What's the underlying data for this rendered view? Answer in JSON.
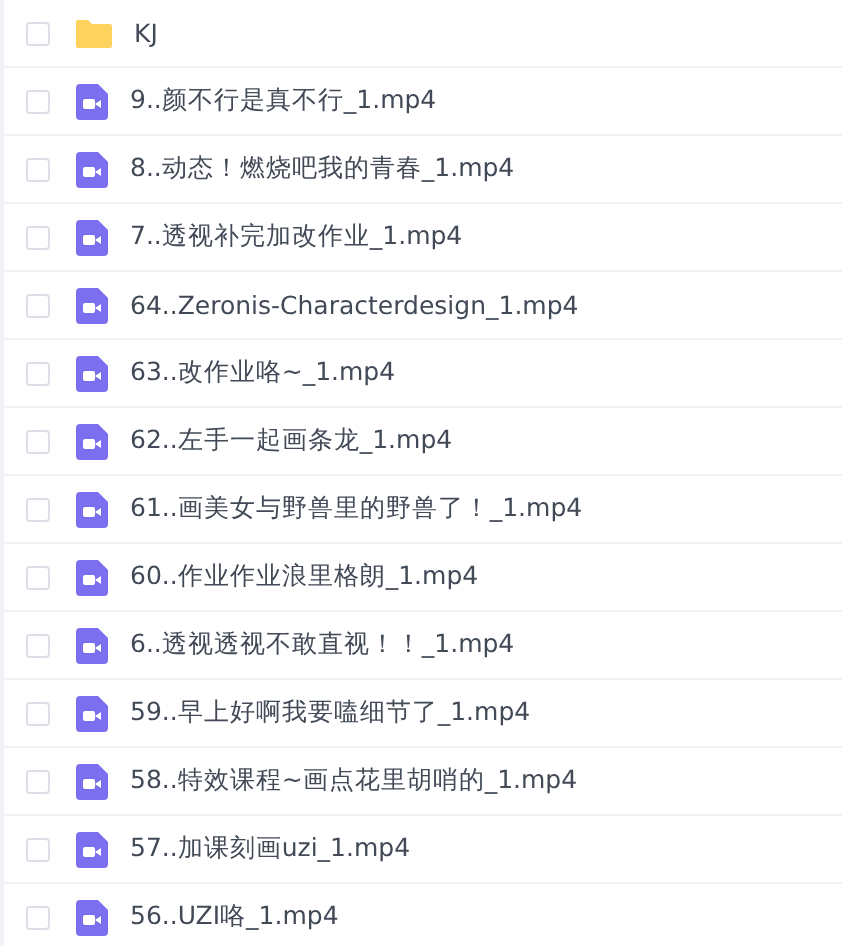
{
  "files": [
    {
      "kind": "folder",
      "name": "KJ",
      "checked": false
    },
    {
      "kind": "video",
      "name": "9..颜不行是真不行_1.mp4",
      "checked": false
    },
    {
      "kind": "video",
      "name": "8..动态！燃烧吧我的青春_1.mp4",
      "checked": false
    },
    {
      "kind": "video",
      "name": "7..透视补完加改作业_1.mp4",
      "checked": false
    },
    {
      "kind": "video",
      "name": "64..Zeronis-Characterdesign_1.mp4",
      "checked": false
    },
    {
      "kind": "video",
      "name": "63..改作业咯~_1.mp4",
      "checked": false
    },
    {
      "kind": "video",
      "name": "62..左手一起画条龙_1.mp4",
      "checked": false
    },
    {
      "kind": "video",
      "name": "61..画美女与野兽里的野兽了！_1.mp4",
      "checked": false
    },
    {
      "kind": "video",
      "name": "60..作业作业浪里格朗_1.mp4",
      "checked": false
    },
    {
      "kind": "video",
      "name": "6..透视透视不敢直视！！_1.mp4",
      "checked": false
    },
    {
      "kind": "video",
      "name": "59..早上好啊我要嗑细节了_1.mp4",
      "checked": false
    },
    {
      "kind": "video",
      "name": "58..特效课程~画点花里胡哨的_1.mp4",
      "checked": false
    },
    {
      "kind": "video",
      "name": "57..加课刻画uzi_1.mp4",
      "checked": false
    },
    {
      "kind": "video",
      "name": "56..UZI咯_1.mp4",
      "checked": false
    }
  ]
}
